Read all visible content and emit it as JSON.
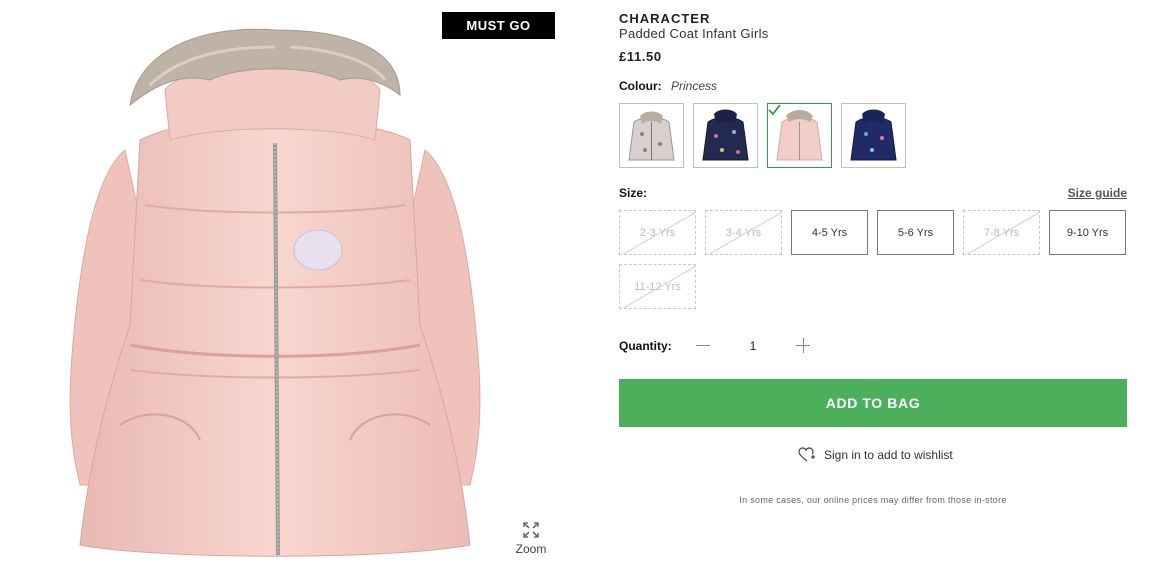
{
  "badge": "MUST GO",
  "zoom_label": "Zoom",
  "product": {
    "brand": "CHARACTER",
    "name": "Padded Coat Infant Girls",
    "price": "£11.50"
  },
  "colour": {
    "label": "Colour:",
    "selected": "Princess",
    "swatches": [
      {
        "icon": "grey-printed-coat-thumbnail"
      },
      {
        "icon": "navy-floral-coat-thumbnail"
      },
      {
        "icon": "pink-coat-thumbnail",
        "selected": true
      },
      {
        "icon": "navy-printed-coat-thumbnail"
      }
    ]
  },
  "size": {
    "label": "Size:",
    "guide": "Size guide",
    "options": [
      {
        "label": "2-3 Yrs",
        "available": false
      },
      {
        "label": "3-4 Yrs",
        "available": false
      },
      {
        "label": "4-5 Yrs",
        "available": true
      },
      {
        "label": "5-6 Yrs",
        "available": true
      },
      {
        "label": "7-8 Yrs",
        "available": false
      },
      {
        "label": "9-10 Yrs",
        "available": true
      },
      {
        "label": "11-12 Yrs",
        "available": false
      }
    ]
  },
  "quantity": {
    "label": "Quantity:",
    "value": "1"
  },
  "add_to_bag": "ADD TO BAG",
  "wishlist": "Sign in to add to wishlist",
  "disclaimer": "In some cases, our online prices may differ from those in-store",
  "colors": {
    "add_to_bag_bg": "#4caf5b",
    "selected_swatch": "#2e9c45",
    "badge_bg": "#000000"
  }
}
